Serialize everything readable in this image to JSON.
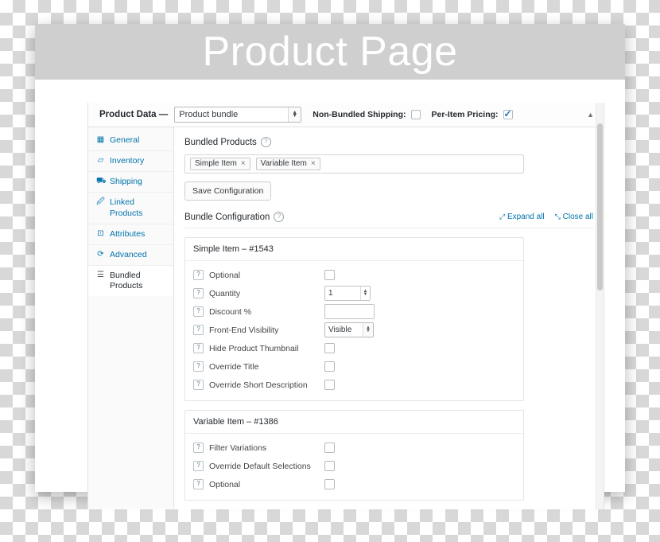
{
  "card": {
    "header_title": "Product Page"
  },
  "panel": {
    "product_data_label": "Product Data —",
    "product_type": "Product bundle",
    "non_bundled_shipping_label": "Non-Bundled Shipping:",
    "non_bundled_shipping_checked": false,
    "per_item_pricing_label": "Per-Item Pricing:",
    "per_item_pricing_checked": true,
    "collapse_icon": "▲"
  },
  "tabs": [
    {
      "label": "General",
      "icon": "▦",
      "active": false
    },
    {
      "label": "Inventory",
      "icon": "▱",
      "active": false
    },
    {
      "label": "Shipping",
      "icon": "⛟",
      "active": false
    },
    {
      "label": "Linked Products",
      "icon": "🖉",
      "active": false
    },
    {
      "label": "Attributes",
      "icon": "⊡",
      "active": false
    },
    {
      "label": "Advanced",
      "icon": "⟳",
      "active": false
    },
    {
      "label": "Bundled Products",
      "icon": "☰",
      "active": true
    }
  ],
  "bundled_products": {
    "section_title": "Bundled Products",
    "help_glyph": "?",
    "tokens": [
      {
        "label": "Simple Item",
        "remove": "×"
      },
      {
        "label": "Variable Item",
        "remove": "×"
      }
    ],
    "save_button": "Save Configuration"
  },
  "bundle_configuration": {
    "section_title": "Bundle Configuration",
    "help_glyph": "?",
    "expand_all": "Expand all",
    "expand_icon": "⤢",
    "close_all": "Close all",
    "close_icon": "⤡",
    "groups": [
      {
        "title": "Simple Item – #1543",
        "fields": [
          {
            "label": "Optional",
            "help": "?",
            "control": "checkbox",
            "value": ""
          },
          {
            "label": "Quantity",
            "help": "?",
            "control": "number",
            "value": "1"
          },
          {
            "label": "Discount %",
            "help": "?",
            "control": "text",
            "value": ""
          },
          {
            "label": "Front-End Visibility",
            "help": "?",
            "control": "select",
            "value": "Visible"
          },
          {
            "label": "Hide Product Thumbnail",
            "help": "?",
            "control": "checkbox",
            "value": ""
          },
          {
            "label": "Override Title",
            "help": "?",
            "control": "checkbox",
            "value": ""
          },
          {
            "label": "Override Short Description",
            "help": "?",
            "control": "checkbox",
            "value": ""
          }
        ]
      },
      {
        "title": "Variable Item – #1386",
        "fields": [
          {
            "label": "Filter Variations",
            "help": "?",
            "control": "checkbox",
            "value": ""
          },
          {
            "label": "Override Default Selections",
            "help": "?",
            "control": "checkbox",
            "value": ""
          },
          {
            "label": "Optional",
            "help": "?",
            "control": "checkbox",
            "value": ""
          }
        ]
      }
    ]
  }
}
